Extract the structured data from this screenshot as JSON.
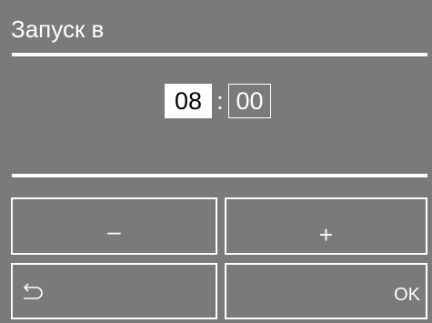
{
  "header": {
    "title": "Запуск в"
  },
  "time": {
    "hours": "08",
    "separator": ":",
    "minutes": "00"
  },
  "buttons": {
    "minus_label": "–",
    "plus_label": "+",
    "back_icon": "back-arrow-icon",
    "ok_label": "OK"
  },
  "colors": {
    "background": "#7a7a7a",
    "foreground": "#ffffff",
    "selected_text": "#000000"
  }
}
